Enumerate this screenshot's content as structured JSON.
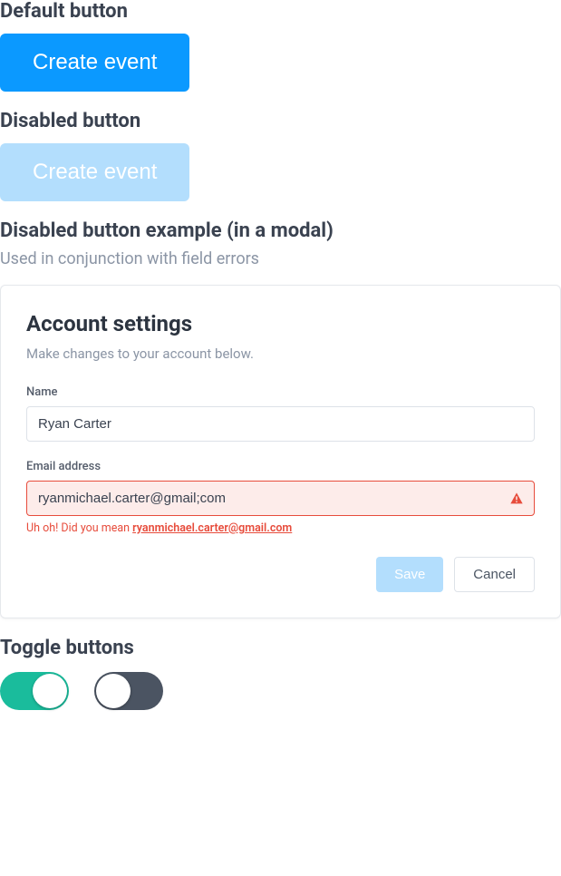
{
  "sections": {
    "default_button": {
      "title": "Default button",
      "button_label": "Create event"
    },
    "disabled_button": {
      "title": "Disabled button",
      "button_label": "Create event"
    },
    "disabled_modal": {
      "title": "Disabled button example (in a modal)",
      "subtitle": "Used in conjunction with field errors"
    },
    "toggle": {
      "title": "Toggle buttons"
    }
  },
  "modal": {
    "title": "Account settings",
    "description": "Make changes to your account below.",
    "fields": {
      "name": {
        "label": "Name",
        "value": "Ryan Carter"
      },
      "email": {
        "label": "Email address",
        "value": "ryanmichael.carter@gmail;com",
        "error_prefix": "Uh oh!  Did you mean ",
        "error_suggestion": "ryanmichael.carter@gmail.com"
      }
    },
    "actions": {
      "save": "Save",
      "cancel": "Cancel"
    }
  },
  "toggles": {
    "on": true,
    "off": false
  },
  "colors": {
    "primary": "#0b99ff",
    "primary_disabled": "#b3defd",
    "error": "#e74c3c",
    "toggle_on": "#1abc9c",
    "toggle_off": "#4b5462"
  }
}
